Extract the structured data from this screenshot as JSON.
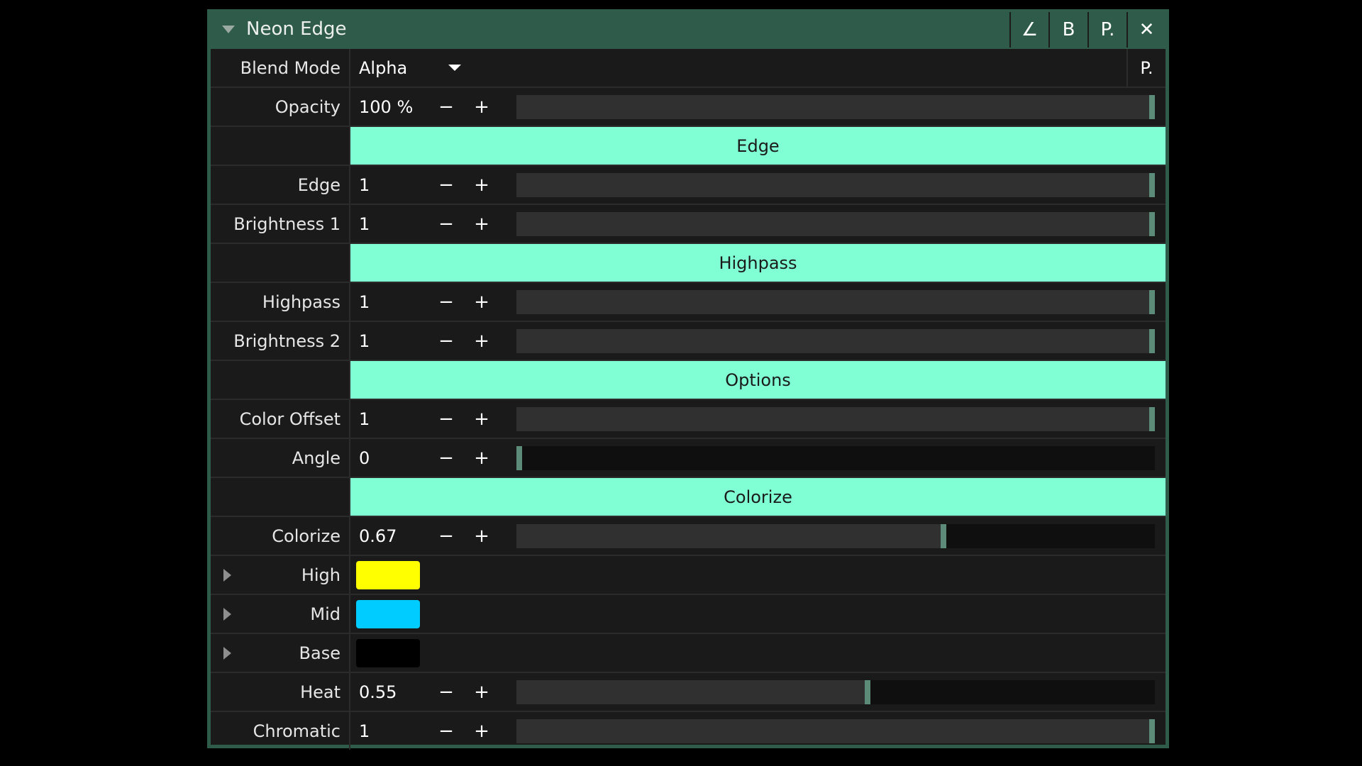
{
  "window": {
    "title": "Neon Edge",
    "buttons": [
      {
        "name": "angle-button",
        "label": "∠"
      },
      {
        "name": "bypass-button",
        "label": "B"
      },
      {
        "name": "preset-button",
        "label": "P."
      },
      {
        "name": "close-button",
        "label": "✕"
      }
    ]
  },
  "blend": {
    "label": "Blend Mode",
    "value": "Alpha",
    "preset_label": "P."
  },
  "stepper": {
    "minus": "−",
    "plus": "+"
  },
  "params": {
    "opacity": {
      "label": "Opacity",
      "value": "100 %",
      "fraction": 1.0
    },
    "edge": {
      "label": "Edge",
      "value": "1",
      "fraction": 1.0
    },
    "brightness1": {
      "label": "Brightness 1",
      "value": "1",
      "fraction": 1.0
    },
    "highpass": {
      "label": "Highpass",
      "value": "1",
      "fraction": 1.0
    },
    "brightness2": {
      "label": "Brightness 2",
      "value": "1",
      "fraction": 1.0
    },
    "color_offset": {
      "label": "Color Offset",
      "value": "1",
      "fraction": 1.0
    },
    "angle": {
      "label": "Angle",
      "value": "0",
      "fraction": 0.0
    },
    "colorize": {
      "label": "Colorize",
      "value": "0.67",
      "fraction": 0.67
    },
    "heat": {
      "label": "Heat",
      "value": "0.55",
      "fraction": 0.55
    },
    "chromatic": {
      "label": "Chromatic",
      "value": "1",
      "fraction": 1.0
    }
  },
  "sections": {
    "edge": "Edge",
    "highpass": "Highpass",
    "options": "Options",
    "colorize": "Colorize"
  },
  "colors": {
    "high": {
      "label": "High",
      "color": "#ffff00"
    },
    "mid": {
      "label": "Mid",
      "color": "#00ccff"
    },
    "base": {
      "label": "Base",
      "color": "#000000"
    }
  },
  "theme": {
    "section_bg": "#80ffd5",
    "panel_border": "#2f5b4b",
    "slider_handle": "#5c8c79"
  }
}
